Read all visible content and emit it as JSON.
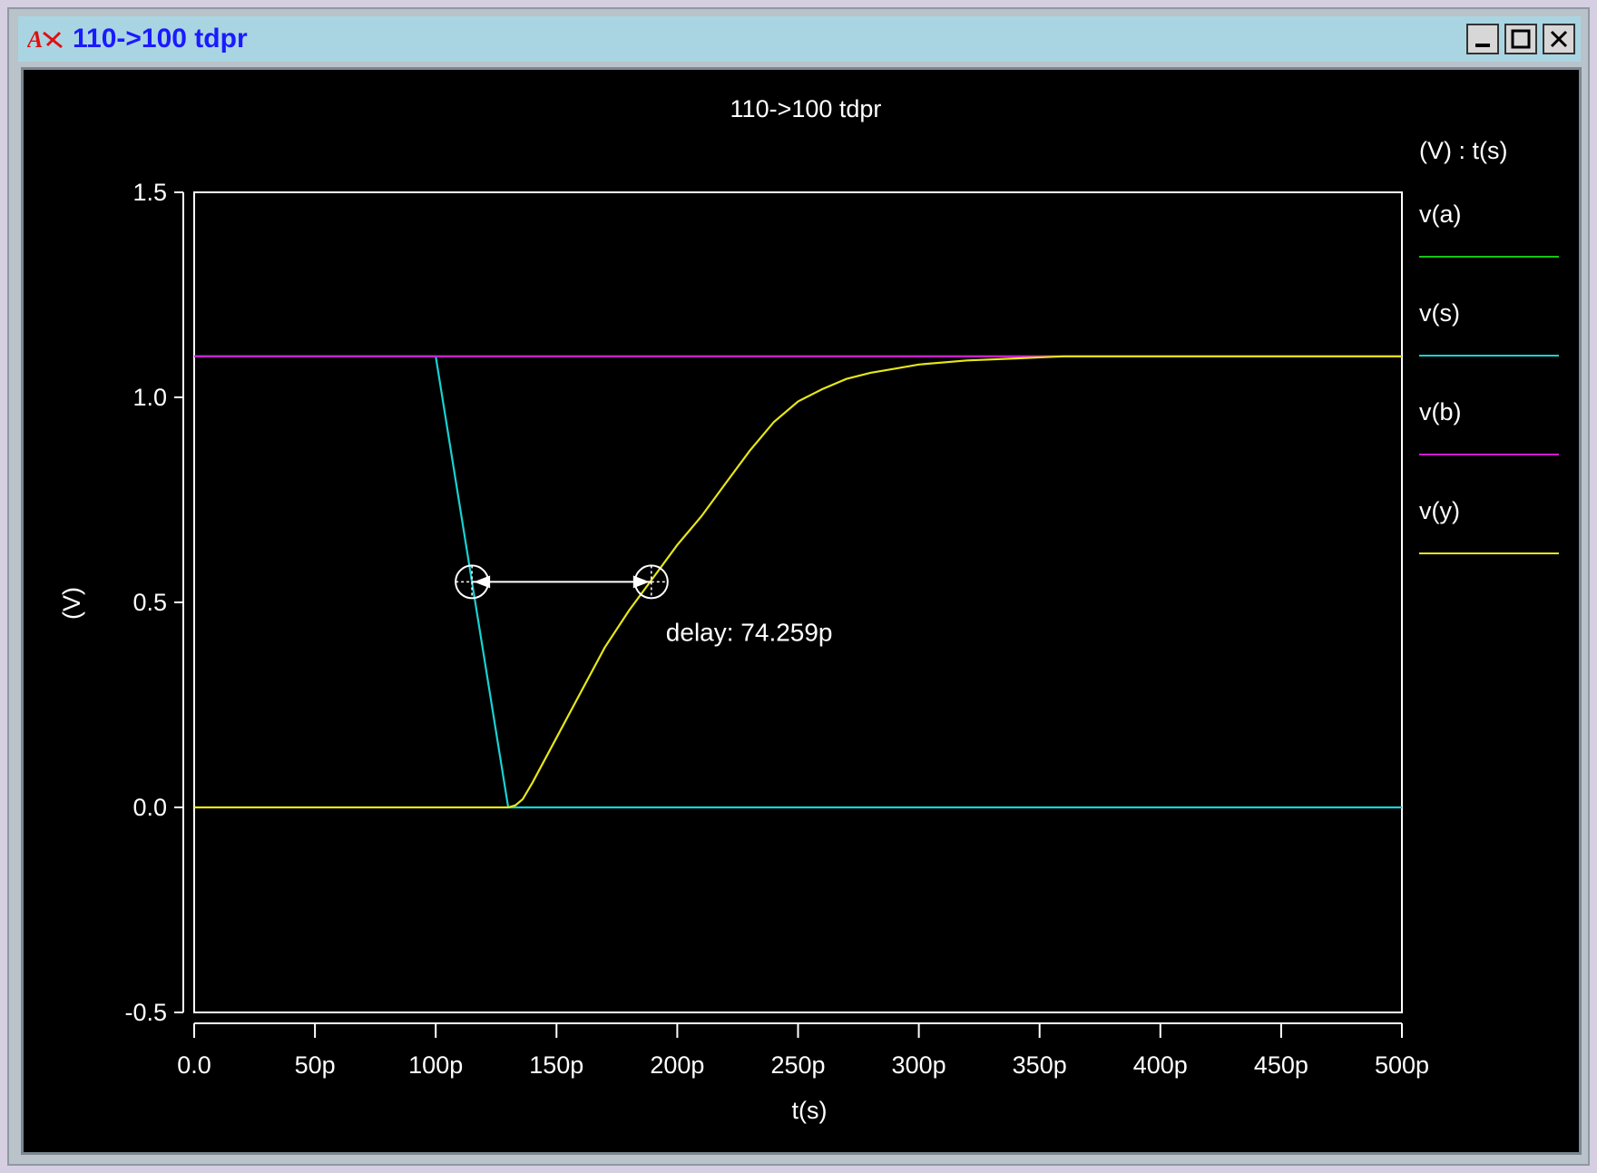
{
  "window": {
    "title": "110->100 tdpr",
    "logo_icon": "app-logo-icon",
    "buttons": [
      "minimize-button",
      "maximize-button",
      "close-button"
    ]
  },
  "colors": {
    "background": "#000000",
    "axes": "#ffffff",
    "v_a": "#17c317",
    "v_s": "#19d2d2",
    "v_b": "#d21ad2",
    "v_y": "#e6e619",
    "title_bar": "#a9d5e3",
    "title_text": "#1a1aff"
  },
  "chart_data": {
    "type": "line",
    "title": "110->100 tdpr",
    "xlabel": "t(s)",
    "ylabel": "(V)",
    "legend_header": "(V) : t(s)",
    "legend_position": "right",
    "xlim": [
      0,
      500
    ],
    "ylim": [
      -0.5,
      1.5
    ],
    "x_ticks": [
      {
        "value": 0,
        "label": "0.0"
      },
      {
        "value": 50,
        "label": "50p"
      },
      {
        "value": 100,
        "label": "100p"
      },
      {
        "value": 150,
        "label": "150p"
      },
      {
        "value": 200,
        "label": "200p"
      },
      {
        "value": 250,
        "label": "250p"
      },
      {
        "value": 300,
        "label": "300p"
      },
      {
        "value": 350,
        "label": "350p"
      },
      {
        "value": 400,
        "label": "400p"
      },
      {
        "value": 450,
        "label": "450p"
      },
      {
        "value": 500,
        "label": "500p"
      }
    ],
    "y_ticks": [
      {
        "value": 1.5,
        "label": "1.5"
      },
      {
        "value": 1.0,
        "label": "1.0"
      },
      {
        "value": 0.5,
        "label": "0.5"
      },
      {
        "value": 0.0,
        "label": "0.0"
      },
      {
        "value": -0.5,
        "label": "-0.5"
      }
    ],
    "series": [
      {
        "name": "v(a)",
        "color": "#17c317",
        "x": [
          0,
          500
        ],
        "y": [
          1.1,
          1.1
        ]
      },
      {
        "name": "v(s)",
        "color": "#19d2d2",
        "x": [
          0,
          100,
          130,
          500
        ],
        "y": [
          1.1,
          1.1,
          0.0,
          0.0
        ]
      },
      {
        "name": "v(b)",
        "color": "#d21ad2",
        "x": [
          0,
          500
        ],
        "y": [
          1.1,
          1.1
        ]
      },
      {
        "name": "v(y)",
        "color": "#e6e619",
        "x": [
          0,
          130,
          133,
          136,
          140,
          150,
          160,
          170,
          180,
          190,
          200,
          210,
          220,
          230,
          240,
          250,
          260,
          270,
          280,
          290,
          300,
          320,
          340,
          360,
          500
        ],
        "y": [
          0.0,
          0.0,
          0.005,
          0.02,
          0.06,
          0.17,
          0.28,
          0.39,
          0.48,
          0.56,
          0.64,
          0.71,
          0.79,
          0.87,
          0.94,
          0.99,
          1.02,
          1.045,
          1.06,
          1.07,
          1.08,
          1.09,
          1.095,
          1.1,
          1.1
        ]
      }
    ],
    "annotations": [
      {
        "type": "delay",
        "label": "delay: 74.259p",
        "x_start": 115,
        "x_end": 189.259,
        "y": 0.55
      }
    ]
  }
}
